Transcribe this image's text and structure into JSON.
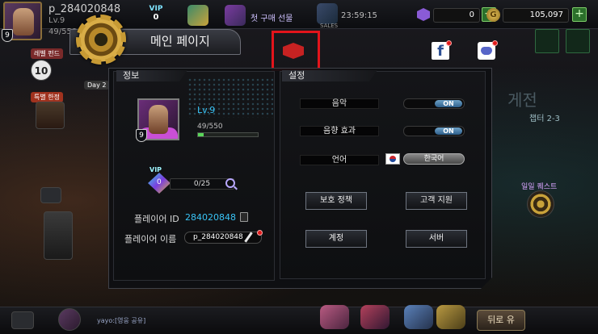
{
  "top": {
    "username": "p_284020848",
    "level_text": "Lv.9",
    "exp_text": "49/550",
    "avatar_level": "9",
    "vip_label": "VIP",
    "vip_level": "0",
    "first_purchase": "첫 구매 선물",
    "sales_label": "SALES",
    "timer": "23:59:15",
    "gems": "0",
    "coins": "105,097",
    "plus_symbol": "+",
    "coin_symbol": "G"
  },
  "header": {
    "title": "메인 페이지",
    "facebook_label": "f"
  },
  "info": {
    "tab": "정보",
    "portrait_level": "9",
    "level": "Lv.9",
    "exp": "49/550",
    "exp_fraction": 0.089,
    "vip_label": "VIP",
    "vip_level": "0",
    "vip_progress": "0/25",
    "player_id_label": "플레이어 ID",
    "player_id": "284020848",
    "player_name_label": "플레이어 이름",
    "player_name": "p_284020848"
  },
  "settings": {
    "tab": "설정",
    "music_label": "음악",
    "music_state": "ON",
    "sfx_label": "음향 효과",
    "sfx_state": "ON",
    "language_label": "언어",
    "language_value": "한국어",
    "buttons": {
      "privacy": "보호 정책",
      "support": "고객 지원",
      "account": "계정",
      "server": "서버"
    }
  },
  "background": {
    "left_badge": "레벨 펀드",
    "left_number": "10",
    "left_day": "Day 2",
    "left_event": "특별 한정",
    "right_big": "게전",
    "right_chapter": "챕터 2-3",
    "right_event": "일일 퀘스트",
    "return_label": "뒤로 유",
    "chat_text": "yayo:[영웅 공유]"
  },
  "colors": {
    "accent_blue": "#39c4f6",
    "highlight_red": "#e3141b",
    "toggle_on": "#2e5f8b",
    "exp_green": "#5ad65a"
  }
}
